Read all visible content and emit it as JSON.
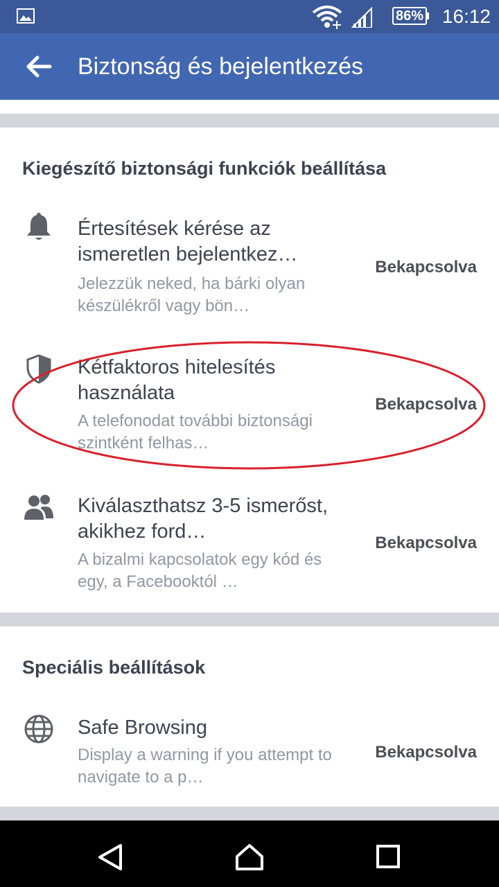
{
  "status_bar": {
    "battery": "86%",
    "time": "16:12"
  },
  "app_bar": {
    "title": "Biztonság és bejelentkezés",
    "back_icon": "arrow-left-icon"
  },
  "sections": [
    {
      "title": "Kiegészítő biztonsági funkciók beállítása",
      "items": [
        {
          "icon": "bell-icon",
          "title": "Értesítések kérése az ismeretlen bejelentkez…",
          "subtitle": "Jelezzük neked, ha bárki olyan készülékről vagy bön…",
          "status": "Bekapcsolva"
        },
        {
          "icon": "shield-icon",
          "title": "Kétfaktoros hitelesítés használata",
          "subtitle": "A telefonodat további biztonsági szintként felhas…",
          "status": "Bekapcsolva"
        },
        {
          "icon": "friends-icon",
          "title": "Kiválaszthatsz 3-5 ismerőst, akikhez ford…",
          "subtitle": "A bizalmi kapcsolatok egy kód és egy, a Facebooktól …",
          "status": "Bekapcsolva"
        }
      ]
    },
    {
      "title": "Speciális beállítások",
      "items": [
        {
          "icon": "globe-icon",
          "title": "Safe Browsing",
          "subtitle": "Display a warning if you attempt to navigate to a p…",
          "status": "Bekapcsolva"
        }
      ]
    }
  ],
  "colors": {
    "status_bar": "#3b5998",
    "app_bar": "#4267b2",
    "divider": "#d4d6db",
    "highlight_ellipse": "#d9202c"
  }
}
